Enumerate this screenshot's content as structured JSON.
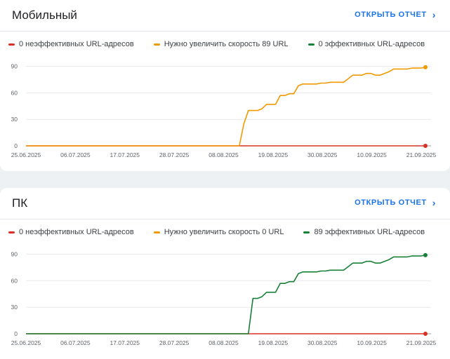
{
  "colors": {
    "poor": "#d93025",
    "needs_improvement": "#f29900",
    "good": "#188038",
    "accent": "#1a73e8"
  },
  "cards": [
    {
      "title": "Мобильный",
      "open_report": "ОТКРЫТЬ ОТЧЕТ",
      "legend": [
        {
          "label": "0 неэффективных URL-адресов",
          "color": "#d93025"
        },
        {
          "label": "Нужно увеличить скорость 89 URL",
          "color": "#f29900"
        },
        {
          "label": "0 эффективных URL-адресов",
          "color": "#188038"
        }
      ],
      "chart_data": {
        "type": "line",
        "x_ticks": [
          "25.06.2025",
          "06.07.2025",
          "17.07.2025",
          "28.07.2025",
          "08.08.2025",
          "19.08.2025",
          "30.08.2025",
          "10.09.2025",
          "21.09.2025"
        ],
        "y_ticks": [
          "0",
          "30",
          "60",
          "90"
        ],
        "ylim": [
          0,
          100
        ],
        "x_range": [
          0,
          88
        ],
        "series": [
          {
            "color": "#d93025",
            "points": [
              [
                0,
                0
              ],
              [
                88,
                0
              ]
            ]
          },
          {
            "color": "#f29900",
            "points": [
              [
                0,
                0
              ],
              [
                47,
                0
              ],
              [
                48,
                25
              ],
              [
                49,
                40
              ],
              [
                51,
                40
              ],
              [
                52,
                42
              ],
              [
                53,
                47
              ],
              [
                55,
                47
              ],
              [
                56,
                57
              ],
              [
                57,
                57
              ],
              [
                58,
                59
              ],
              [
                59,
                59
              ],
              [
                60,
                68
              ],
              [
                61,
                70
              ],
              [
                64,
                70
              ],
              [
                65,
                71
              ],
              [
                66,
                71
              ],
              [
                67,
                72
              ],
              [
                70,
                72
              ],
              [
                72,
                80
              ],
              [
                74,
                80
              ],
              [
                75,
                82
              ],
              [
                76,
                82
              ],
              [
                77,
                80
              ],
              [
                78,
                80
              ],
              [
                80,
                84
              ],
              [
                81,
                87
              ],
              [
                84,
                87
              ],
              [
                85,
                88
              ],
              [
                87,
                88
              ],
              [
                88,
                89
              ]
            ]
          }
        ]
      }
    },
    {
      "title": "ПК",
      "open_report": "ОТКРЫТЬ ОТЧЕТ",
      "legend": [
        {
          "label": "0 неэффективных URL-адресов",
          "color": "#d93025"
        },
        {
          "label": "Нужно увеличить скорость 0 URL",
          "color": "#f29900"
        },
        {
          "label": "89 эффективных URL-адресов",
          "color": "#188038"
        }
      ],
      "chart_data": {
        "type": "line",
        "x_ticks": [
          "25.06.2025",
          "06.07.2025",
          "17.07.2025",
          "28.07.2025",
          "08.08.2025",
          "19.08.2025",
          "30.08.2025",
          "10.09.2025",
          "21.09.2025"
        ],
        "y_ticks": [
          "0",
          "30",
          "60",
          "90"
        ],
        "ylim": [
          0,
          100
        ],
        "x_range": [
          0,
          88
        ],
        "series": [
          {
            "color": "#d93025",
            "points": [
              [
                0,
                0
              ],
              [
                88,
                0
              ]
            ]
          },
          {
            "color": "#188038",
            "points": [
              [
                0,
                0
              ],
              [
                49,
                0
              ],
              [
                50,
                40
              ],
              [
                51,
                40
              ],
              [
                52,
                42
              ],
              [
                53,
                47
              ],
              [
                55,
                47
              ],
              [
                56,
                57
              ],
              [
                57,
                57
              ],
              [
                58,
                59
              ],
              [
                59,
                59
              ],
              [
                60,
                68
              ],
              [
                61,
                70
              ],
              [
                64,
                70
              ],
              [
                65,
                71
              ],
              [
                66,
                71
              ],
              [
                67,
                72
              ],
              [
                70,
                72
              ],
              [
                72,
                80
              ],
              [
                74,
                80
              ],
              [
                75,
                82
              ],
              [
                76,
                82
              ],
              [
                77,
                80
              ],
              [
                78,
                80
              ],
              [
                80,
                84
              ],
              [
                81,
                87
              ],
              [
                84,
                87
              ],
              [
                85,
                88
              ],
              [
                87,
                88
              ],
              [
                88,
                89
              ]
            ]
          }
        ]
      }
    }
  ]
}
